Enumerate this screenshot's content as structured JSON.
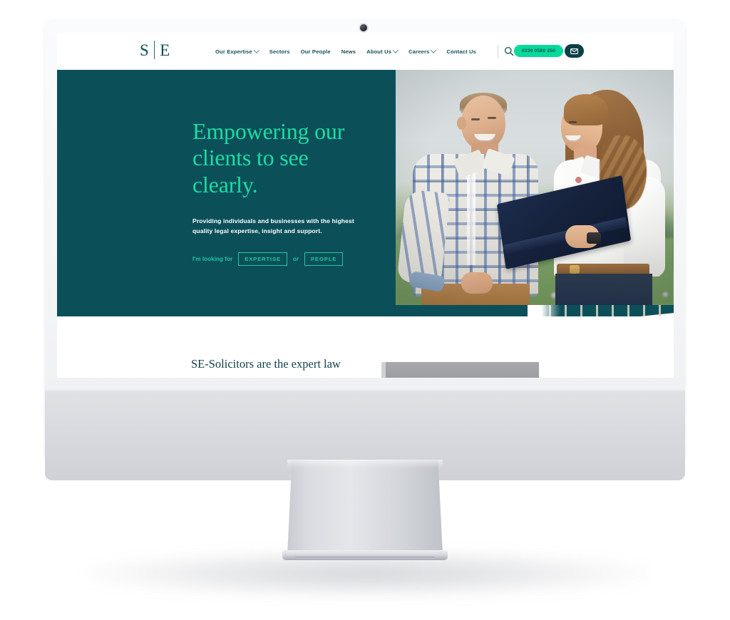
{
  "device": {
    "type": "desktop-monitor-mockup",
    "webcam": "webcam-dot"
  },
  "site": {
    "header": {
      "logo": {
        "left": "S",
        "right": "E"
      },
      "nav_items": [
        {
          "label": "Our Expertise",
          "has_dropdown": true
        },
        {
          "label": "Sectors",
          "has_dropdown": false
        },
        {
          "label": "Our People",
          "has_dropdown": false
        },
        {
          "label": "News",
          "has_dropdown": false
        },
        {
          "label": "About Us",
          "has_dropdown": true
        },
        {
          "label": "Careers",
          "has_dropdown": true
        },
        {
          "label": "Contact Us",
          "has_dropdown": false
        }
      ],
      "search_icon": "search-icon",
      "phone_label": "0330 0580 250",
      "mail_icon": "envelope-icon"
    },
    "hero": {
      "title": "Empowering our clients to see clearly.",
      "subtitle": "Providing individuals and businesses with the highest quality legal expertise, insight and support.",
      "cta_prefix": "I'm looking for",
      "cta_primary": "EXPERTISE",
      "cta_conjunction": "or",
      "cta_secondary": "PEOPLE",
      "photo_alt": "Man in plaid shirt and woman in white shirt holding a navy folder, standing in a flowering field"
    },
    "below": {
      "heading": "SE-Solicitors are the expert law"
    }
  },
  "colors": {
    "teal_panel": "#0b5059",
    "accent_green": "#1ddba4",
    "phone_pill": "#05d99b",
    "mail_pill": "#0c3f46",
    "heading_dark": "#123f4d",
    "grid_pattern": "#ded4c4"
  }
}
